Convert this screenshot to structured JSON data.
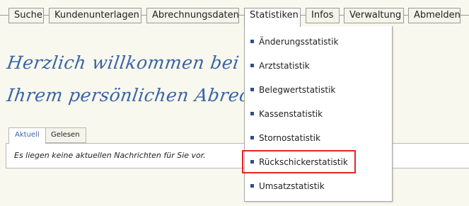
{
  "nav": {
    "items": [
      {
        "label": "Suche"
      },
      {
        "label": "Kundenunterlagen"
      },
      {
        "label": "Abrechnungsdaten"
      },
      {
        "label": "Statistiken"
      },
      {
        "label": "Infos"
      },
      {
        "label": "Verwaltung"
      },
      {
        "label": "Abmelden"
      }
    ],
    "active": "Statistiken"
  },
  "dropdown": {
    "items": [
      {
        "label": "Änderungsstatistik"
      },
      {
        "label": "Arztstatistik"
      },
      {
        "label": "Belegwertstatistik"
      },
      {
        "label": "Kassenstatistik"
      },
      {
        "label": "Stornostatistik"
      },
      {
        "label": "Rückschickerstatistik"
      },
      {
        "label": "Umsatzstatistik"
      }
    ],
    "highlighted": "Rückschickerstatistik"
  },
  "welcome": {
    "line1": "Herzlich willkommen bei der DZH",
    "line2": "Ihrem persönlichen Abrechnungshaus"
  },
  "tabs": [
    {
      "label": "Aktuell"
    },
    {
      "label": "Gelesen"
    }
  ],
  "message": "Es liegen keine aktuellen Nachrichten für Sie vor.",
  "colors": {
    "accent": "#3a64a8",
    "bullet": "#2a4f8f",
    "highlight": "#e32626",
    "background": "#f8f8ee"
  }
}
